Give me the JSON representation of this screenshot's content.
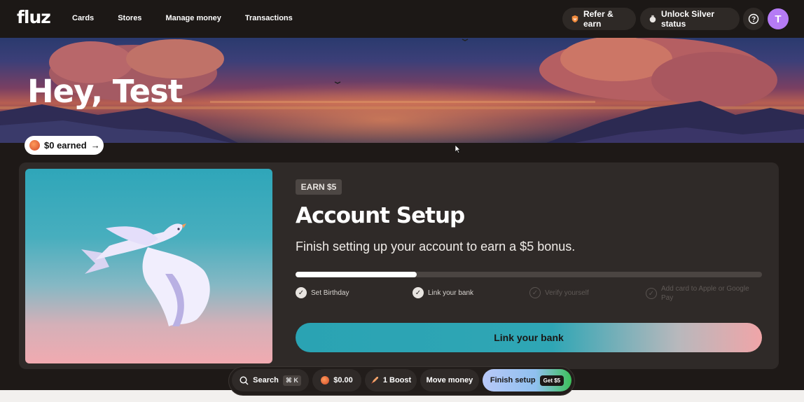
{
  "brand": {
    "logo": "fluz"
  },
  "nav": {
    "links": [
      "Cards",
      "Stores",
      "Manage money",
      "Transactions"
    ]
  },
  "header": {
    "refer_label": "Refer & earn",
    "unlock_label": "Unlock Silver status",
    "help_icon": "question-circle-icon",
    "avatar_initial": "T",
    "avatar_color": "#b57bf5"
  },
  "hero": {
    "greeting": "Hey, Test",
    "earned_label": "$0 earned",
    "earned_arrow": "→"
  },
  "setup": {
    "badge": "EARN $5",
    "title": "Account Setup",
    "subtitle": "Finish setting up your account to earn a $5 bonus.",
    "progress_fraction": 0.26,
    "steps": [
      {
        "label": "Set Birthday",
        "done": true
      },
      {
        "label": "Link your bank",
        "done": true
      },
      {
        "label": "Verify yourself",
        "done": false
      },
      {
        "label": "Add card to Apple or Google Pay",
        "done": false
      }
    ],
    "cta_label": "Link your bank"
  },
  "dock": {
    "search_label": "Search",
    "search_shortcut": "⌘ K",
    "balance": "$0.00",
    "boost_label": "1 Boost",
    "move_money_label": "Move money",
    "finish_label": "Finish setup",
    "finish_badge": "Get $5"
  },
  "colors": {
    "accent_teal": "#2aa3b3",
    "accent_pink": "#f0a5a8",
    "card_bg": "#2f2a28"
  }
}
